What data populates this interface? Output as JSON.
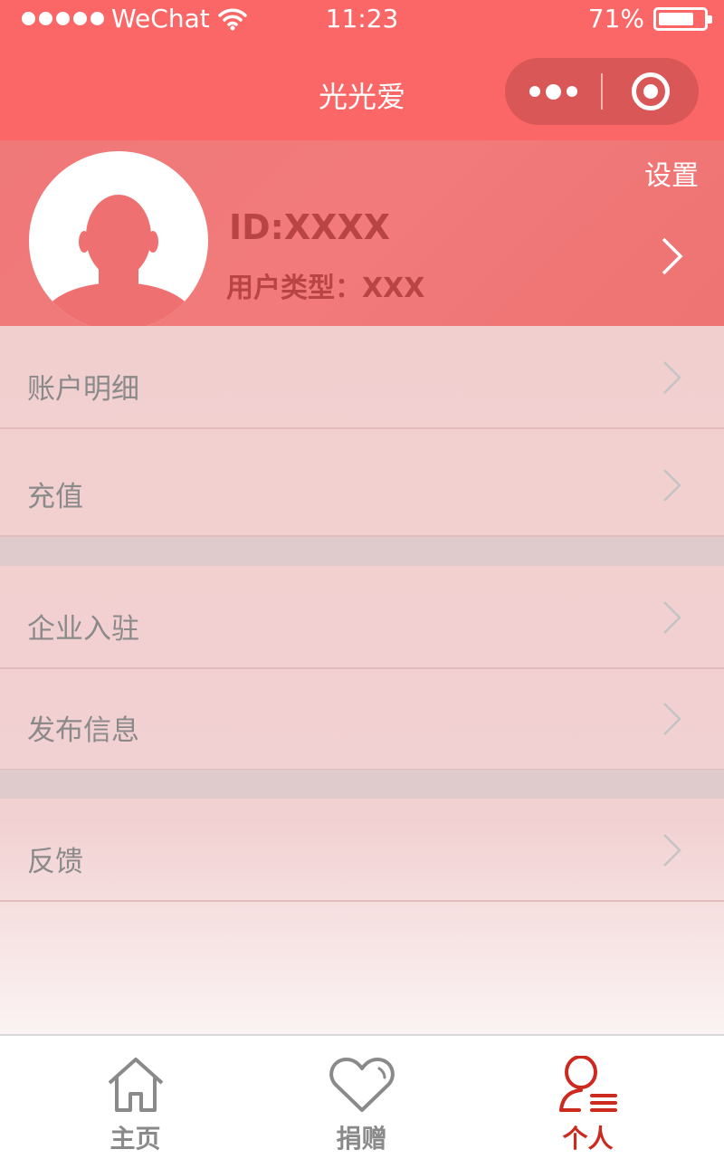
{
  "status_bar": {
    "carrier": "WeChat",
    "time": "11:23",
    "battery_percent": "71%"
  },
  "nav": {
    "title": "光光爱"
  },
  "profile": {
    "settings_label": "设置",
    "user_id": "ID:XXXX",
    "user_type": "用户类型：XXX"
  },
  "menu": {
    "items": [
      {
        "label": "账户明细"
      },
      {
        "label": "充值"
      },
      {
        "label": "企业入驻"
      },
      {
        "label": "发布信息"
      },
      {
        "label": "反馈"
      }
    ]
  },
  "tabbar": {
    "tabs": [
      {
        "label": "主页",
        "icon": "home-icon"
      },
      {
        "label": "捐赠",
        "icon": "heart-icon"
      },
      {
        "label": "个人",
        "icon": "person-icon"
      }
    ],
    "active_index": 2
  },
  "colors": {
    "brand": "#fb6767",
    "active_tab": "#cc2a1f",
    "inactive_tab": "#8a8a8a"
  }
}
